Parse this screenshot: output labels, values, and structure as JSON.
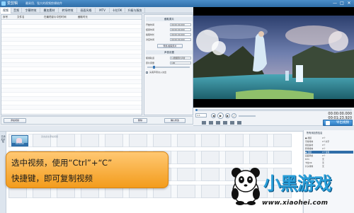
{
  "window": {
    "title": "爱剪辑",
    "subtitle": "最易用、强大的视频剪辑软件",
    "controls": [
      "—",
      "□",
      "✕"
    ]
  },
  "tabs": [
    {
      "label": "视频",
      "active": true
    },
    {
      "label": "音频",
      "active": false
    },
    {
      "label": "字幕特效",
      "active": false
    },
    {
      "label": "叠加素材",
      "active": false
    },
    {
      "label": "转场特效",
      "active": false
    },
    {
      "label": "画面风格",
      "active": false
    },
    {
      "label": "MTV",
      "active": false
    },
    {
      "label": "卡拉OK",
      "active": false
    },
    {
      "label": "升级与服务",
      "active": false
    }
  ],
  "file_list": {
    "columns": [
      "序号",
      "文件名",
      "在最终影片中的时间",
      "截取时长"
    ],
    "rows": []
  },
  "settings": {
    "clip_section": "截取原片",
    "fields": [
      {
        "label": "开始时间",
        "value": "00:00:00.000"
      },
      {
        "label": "结束时间",
        "value": "00:00:00.000"
      },
      {
        "label": "截取时长",
        "value": "00:00:00.000"
      },
      {
        "label": "对应时间",
        "value": "00:00:00.000"
      }
    ],
    "preview_button": "预览/截取原片",
    "audio_section": "声音设置",
    "audio_fields": [
      {
        "label": "使用轨道",
        "value": "1.视频原片声音"
      },
      {
        "label": "原片音量",
        "value": "100"
      }
    ],
    "head_tail_label": "头尾声音淡入淡出",
    "confirm_button": "确认修改"
  },
  "left_toolbar": {
    "add_video": "添加视频",
    "delete": "删除"
  },
  "player": {
    "current_time": "00:00:00.000",
    "total_time": "00:01:23.920",
    "zoom_label": "1:1"
  },
  "storyboard": {
    "side_tab": "已添加片段",
    "clip_label": "00:00:00",
    "hint": "双击此处添加视频"
  },
  "export_button": "导出视频",
  "info_panel": {
    "title": "所有添加的信息",
    "rows": [
      {
        "k": "● 视频",
        "v": "0个",
        "sel": false
      },
      {
        "k": "  字幕特效",
        "v": "0个文字",
        "sel": false
      },
      {
        "k": "  叠加素材",
        "v": "0个",
        "sel": false
      },
      {
        "k": "  转场特效",
        "v": "0个",
        "sel": false
      },
      {
        "k": "● 音频",
        "v": "0个音频",
        "sel": true
      },
      {
        "k": "  画面风格",
        "v": "0个",
        "sel": false
      },
      {
        "k": "  MTV",
        "v": "无",
        "sel": false
      },
      {
        "k": "  卡拉OK",
        "v": "无",
        "sel": false
      },
      {
        "k": "  片头特效",
        "v": "无",
        "sel": false
      }
    ]
  },
  "callout": {
    "line1": "选中视频，使用“Ctrl”+“C”",
    "line2": "快捷键，即可复制视频"
  },
  "watermark": {
    "logo": "小黑游戏",
    "url": "www.xiaohei.com"
  },
  "colors": {
    "accent": "#2f6ea8",
    "callout": "#f39c1c"
  }
}
